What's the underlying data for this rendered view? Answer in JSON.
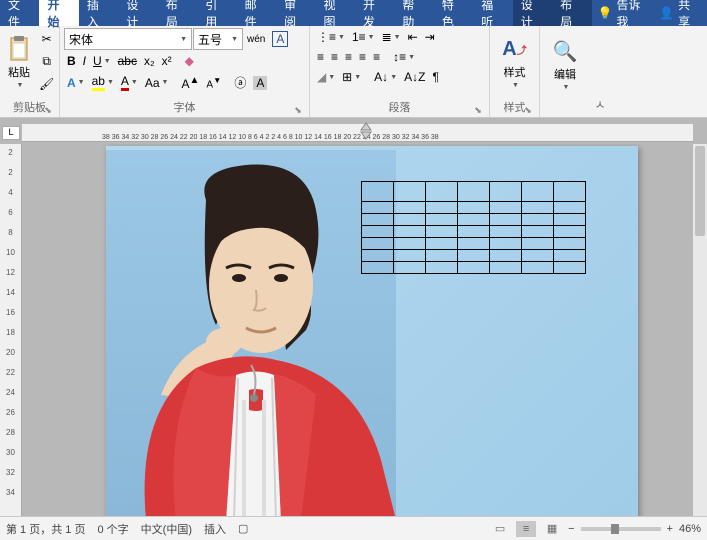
{
  "menu": {
    "file": "文件",
    "tabs": [
      "开始",
      "插入",
      "设计",
      "布局",
      "引用",
      "邮件",
      "审阅",
      "视图",
      "开发",
      "帮助",
      "特色",
      "福听"
    ],
    "context_tabs": [
      "设计",
      "布局"
    ],
    "tell_me": "告诉我",
    "share": "共享"
  },
  "ribbon": {
    "clipboard": {
      "label": "剪贴板",
      "paste": "粘贴"
    },
    "font": {
      "label": "字体",
      "family": "宋体",
      "size": "五号",
      "bold": "B",
      "italic": "I",
      "underline": "U",
      "strike": "abc"
    },
    "paragraph": {
      "label": "段落"
    },
    "styles": {
      "label": "样式",
      "btn": "样式"
    },
    "editing": {
      "btn": "编辑"
    }
  },
  "ruler": {
    "corner": "L",
    "h_ticks": "38 36 34 32 30 28 26 24 22 20 18 16 14 12 10  8  6  4  2     2  4  6  8 10 12 14 16 18 20 22 24 26 28 30 32 34 36 38",
    "v_ticks": [
      2,
      2,
      4,
      6,
      8,
      10,
      12,
      14,
      16,
      18,
      20,
      22,
      24,
      26,
      28,
      30,
      32,
      34
    ]
  },
  "doc": {
    "table_rows": 7,
    "table_cols": 7
  },
  "status": {
    "page": "第 1 页，共 1 页",
    "words": "0 个字",
    "lang": "中文(中国)",
    "mode": "插入",
    "zoom": "46%"
  }
}
